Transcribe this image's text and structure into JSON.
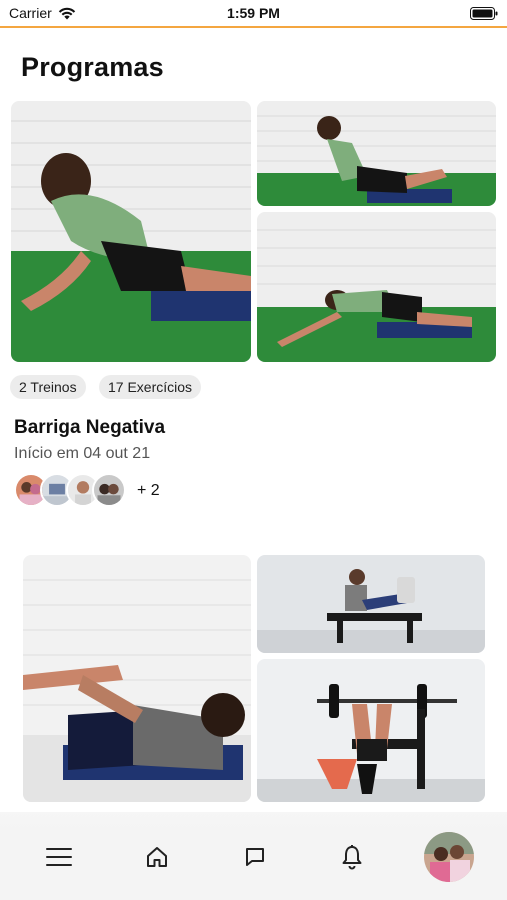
{
  "status_bar": {
    "carrier": "Carrier",
    "time": "1:59 PM"
  },
  "page": {
    "title": "Programas"
  },
  "programs": [
    {
      "tags": [
        "2 Treinos",
        "17 Exercícios"
      ],
      "name": "Barriga Negativa",
      "start_date": "Início em 04 out 21",
      "participants_more": "+ 2"
    }
  ],
  "nav": {
    "icons": [
      "menu-icon",
      "home-icon",
      "chat-icon",
      "bell-icon",
      "profile-avatar"
    ]
  },
  "colors": {
    "accent": "#f4a640",
    "grass": "#2e8b3a",
    "wall": "#eeeeee",
    "mat": "#1f3470"
  }
}
